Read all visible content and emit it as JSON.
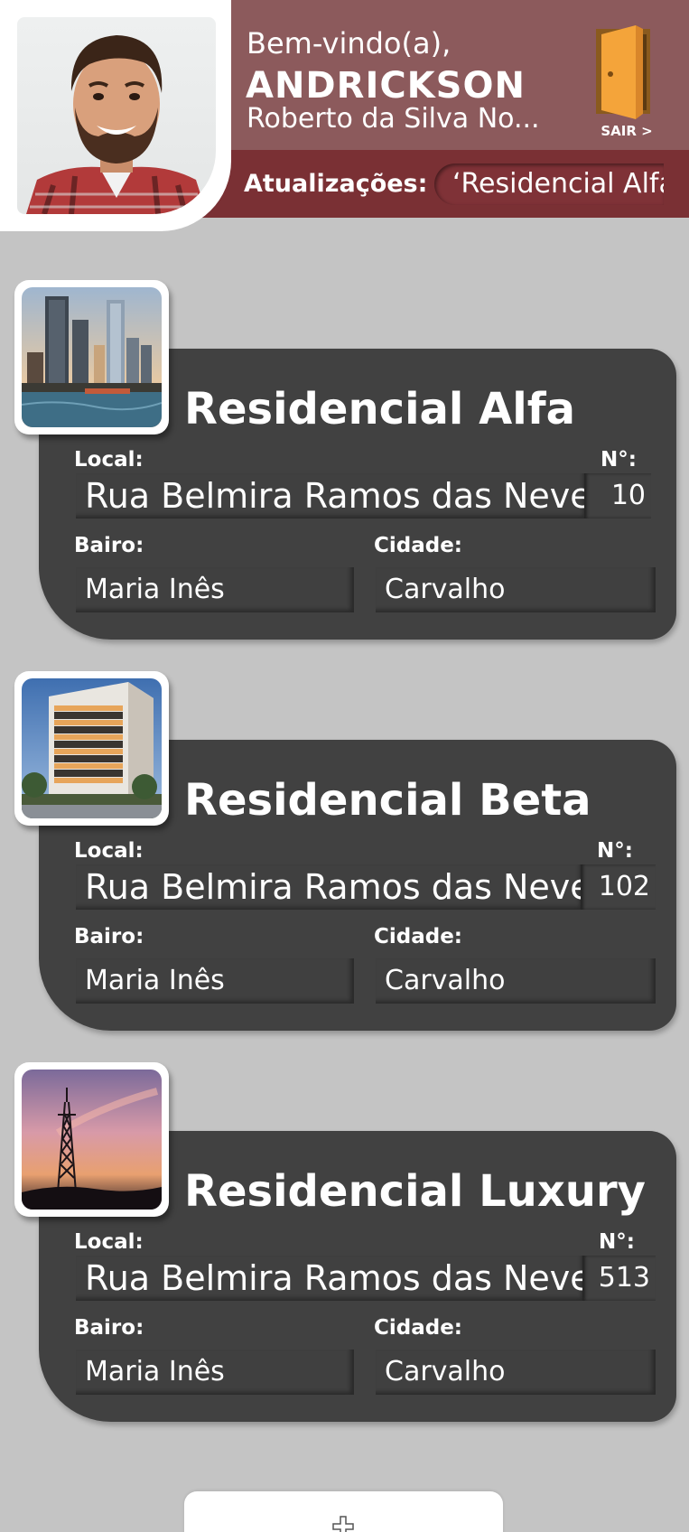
{
  "header": {
    "welcome": "Bem-vindo(a),",
    "user_first_name": "ANDRICKSON",
    "user_rest_name": "Roberto da Silva No...",
    "logout_label": "SAIR >",
    "updates_label": "Atualizações:",
    "updates_ticker": "‘Residencial Alfa"
  },
  "labels": {
    "local": "Local:",
    "number": "N°:",
    "neighborhood": "Bairo:",
    "city": "Cidade:"
  },
  "properties": [
    {
      "name": "Residencial Alfa",
      "address": "Rua Belmira Ramos das Neves",
      "number": "10",
      "neighborhood": "Maria Inês",
      "city": "Carvalho",
      "image": "city-skyline-waterfront"
    },
    {
      "name": "Residencial Beta",
      "address": "Rua Belmira Ramos das Neves",
      "number": "102",
      "neighborhood": "Maria Inês",
      "city": "Carvalho",
      "image": "apartment-tower"
    },
    {
      "name": "Residencial Luxury",
      "address": "Rua Belmira Ramos das Neves",
      "number": "513",
      "neighborhood": "Maria Inês",
      "city": "Carvalho",
      "image": "radio-tower-sunset"
    }
  ],
  "add_button": {
    "icon": "plus-icon"
  },
  "colors": {
    "background": "#c4c4c4",
    "header_top": "#8c5a5c",
    "header_bottom": "#7a3034",
    "card": "#414141",
    "door": "#f4a43a"
  }
}
